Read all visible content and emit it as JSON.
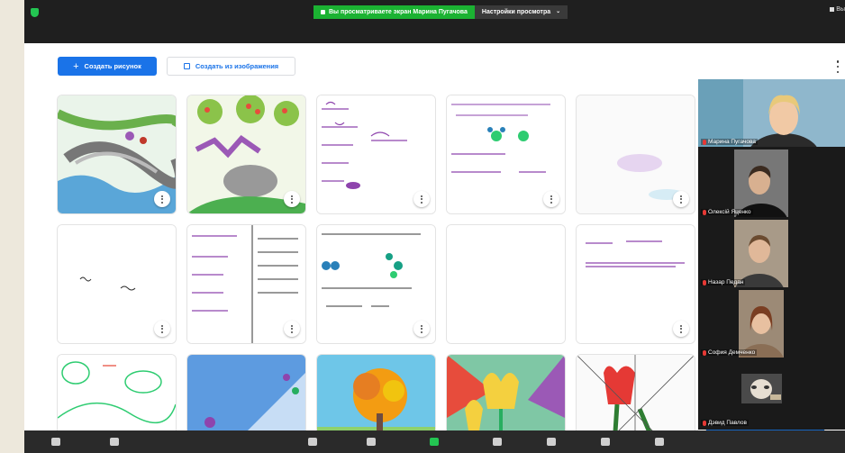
{
  "share_banner": {
    "viewing_text": "Вы просматриваете экран Марина Пугачова",
    "view_settings": "Настройки просмотра",
    "right_text": "Вы"
  },
  "toolbar": {
    "create_drawing": "Создать рисунок",
    "create_from_image": "Создать из изображения"
  },
  "participants": [
    {
      "name": "Марина Пугачова"
    },
    {
      "name": "Олексій Яценко"
    },
    {
      "name": "Назар Педан"
    },
    {
      "name": "София Демченко"
    },
    {
      "name": "Дэвид Павлов"
    }
  ],
  "colors": {
    "primary": "#1a73e8",
    "share_green": "#1bb232",
    "muted_red": "#e53935"
  }
}
